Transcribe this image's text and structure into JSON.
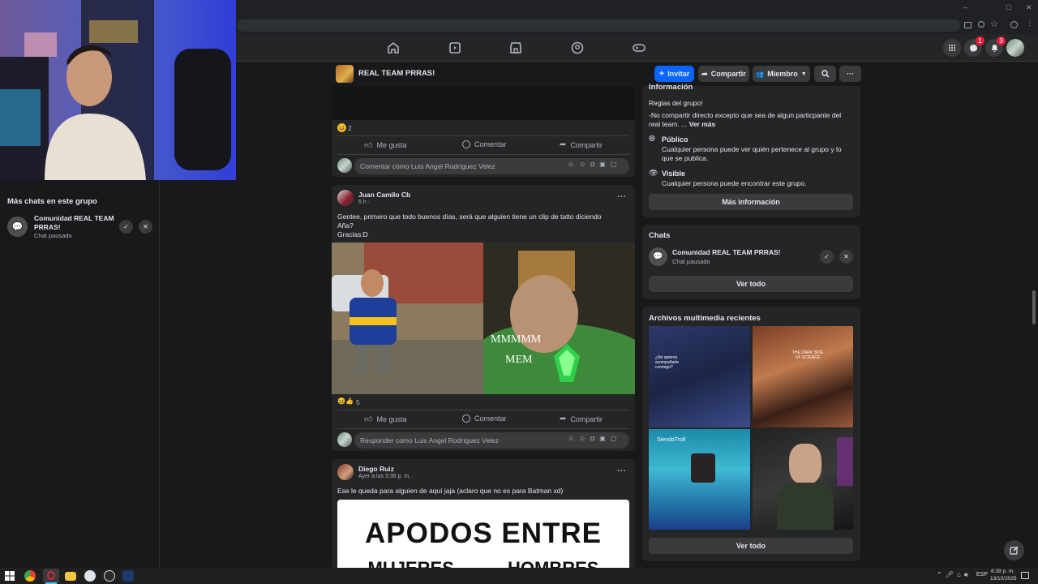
{
  "browser": {
    "window_controls": [
      "–",
      "▢",
      "✕"
    ]
  },
  "nav": {
    "messenger_badge": "1",
    "notifications_badge": "3"
  },
  "group": {
    "name": "REAL TEAM PRRAS!",
    "invite_label": "Invitar",
    "share_label": "Compartir",
    "member_label": "Miembro"
  },
  "left_panel": {
    "title": "Más chats en este grupo",
    "chat_name": "Comunidad REAL TEAM PRRAS!",
    "chat_status": "Chat pausado"
  },
  "post1": {
    "reaction_count": "2",
    "like_label": "Me gusta",
    "comment_label": "Comentar",
    "share_label": "Compartir",
    "comment_placeholder": "Comentar como Luis Angel Rodríguez Velez"
  },
  "post2": {
    "author": "Juan Camilo Cb",
    "time": "5 h ·",
    "text_line1": "Gentee, primero que todo buenos días, será que alguien tiene un clip de tatto diciendo",
    "text_line2": "Aña?",
    "text_line3": "Gracias:D",
    "image_caption_1": "MMMMM",
    "image_caption_2": "MEM",
    "reaction_count": "5",
    "like_label": "Me gusta",
    "comment_label": "Comentar",
    "share_label": "Compartir",
    "reply_placeholder": "Responder como Luis Angel Rodríguez Velez"
  },
  "post3": {
    "author": "Diego Ruiz",
    "time": "Ayer a las 3:36 p. m. ·",
    "text": "Ese le queda para alguien de aquí jaja (aclaro que no es para Batman xd)",
    "image_title": "APODOS ENTRE",
    "image_sub": "MUJERES HOMBRES"
  },
  "sidebar": {
    "info_title": "Información",
    "rules": "Reglas del grupo!",
    "rule_text": "-No compartir directo excepto que sea de algun particpante del real team. ...",
    "see_more": "Ver más",
    "public_title": "Público",
    "public_desc": "Cualquier persona puede ver quién pertenece al grupo y lo que se publica.",
    "visible_title": "Visible",
    "visible_desc": "Cualquier persona puede encontrar este grupo.",
    "more_info_button": "Más información",
    "chats_title": "Chats",
    "chat_name": "Comunidad REAL TEAM PRRAS!",
    "chat_status": "Chat pausado",
    "see_all_chats": "Ver todo",
    "media_title": "Archivos multimedia recientes",
    "media_caption_1": "¿No quieres acompañarte conmigo?",
    "media_caption_2": "THE DARK SIDE OF SCIENCE",
    "media_caption_3": "SiendoTroll",
    "see_all_media": "Ver todo"
  },
  "taskbar": {
    "language": "ESP",
    "time": "8:39 p. m.",
    "date": "13/10/2025"
  }
}
